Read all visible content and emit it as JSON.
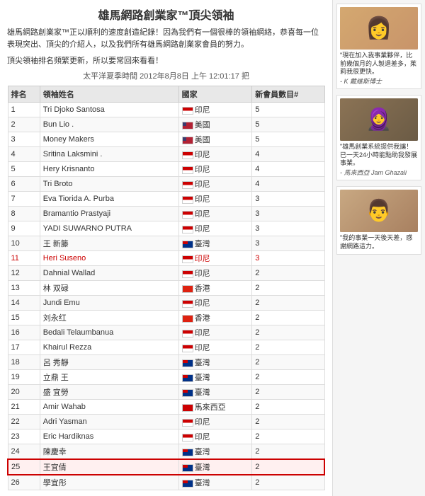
{
  "page": {
    "title": "雄馬網路創業家™頂尖領袖",
    "description": "雄馬網路創業家™正以順利的速度創造紀錄！因為我們有一個很棒的領袖網絡，恭喜每一位表現突出、頂尖的介紹人，以及我們所有雄馬網路創業家會員的努力。",
    "notice": "頂尖領袖排名頻繁更新，所以要常回來看看！",
    "timestamp": "太平洋夏季時間 2012年8月8日 上午 12:01:17 把"
  },
  "table": {
    "headers": [
      "排名",
      "領袖姓名",
      "國家",
      "新會員數目#"
    ],
    "rows": [
      {
        "rank": "1",
        "name": "Tri Djoko Santosa",
        "country": "印尼",
        "flag": "id",
        "count": "5"
      },
      {
        "rank": "2",
        "name": "Bun Lio .",
        "country": "美國",
        "flag": "us",
        "count": "5"
      },
      {
        "rank": "3",
        "name": "Money Makers",
        "country": "美國",
        "flag": "us",
        "count": "5"
      },
      {
        "rank": "4",
        "name": "Sritina Laksmini .",
        "country": "印尼",
        "flag": "id",
        "count": "4"
      },
      {
        "rank": "5",
        "name": "Hery Krisnanto",
        "country": "印尼",
        "flag": "id",
        "count": "4"
      },
      {
        "rank": "6",
        "name": "Tri Broto",
        "country": "印尼",
        "flag": "id",
        "count": "4"
      },
      {
        "rank": "7",
        "name": "Eva Tiorida A. Purba",
        "country": "印尼",
        "flag": "id",
        "count": "3"
      },
      {
        "rank": "8",
        "name": "Bramantio Prastyaji",
        "country": "印尼",
        "flag": "id",
        "count": "3"
      },
      {
        "rank": "9",
        "name": "YADI SUWARNO PUTRA",
        "country": "印尼",
        "flag": "id",
        "count": "3"
      },
      {
        "rank": "10",
        "name": "王 新籐",
        "country": "臺灣",
        "flag": "tw",
        "count": "3"
      },
      {
        "rank": "11",
        "name": "Heri Suseno",
        "country": "印尼",
        "flag": "id",
        "count": "3"
      },
      {
        "rank": "12",
        "name": "Dahnial Wallad",
        "country": "印尼",
        "flag": "id",
        "count": "2"
      },
      {
        "rank": "13",
        "name": "林 双碌",
        "country": "香港",
        "flag": "hk",
        "count": "2"
      },
      {
        "rank": "14",
        "name": "Jundi Emu",
        "country": "印尼",
        "flag": "id",
        "count": "2"
      },
      {
        "rank": "15",
        "name": "刘永红",
        "country": "香港",
        "flag": "hk",
        "count": "2"
      },
      {
        "rank": "16",
        "name": "Bedali Telaumbanua",
        "country": "印尼",
        "flag": "id",
        "count": "2"
      },
      {
        "rank": "17",
        "name": "Khairul Rezza",
        "country": "印尼",
        "flag": "id",
        "count": "2"
      },
      {
        "rank": "18",
        "name": "呂 秀靜",
        "country": "臺灣",
        "flag": "tw",
        "count": "2"
      },
      {
        "rank": "19",
        "name": "立鼎 王",
        "country": "臺灣",
        "flag": "tw",
        "count": "2"
      },
      {
        "rank": "20",
        "name": "盛 宜勞",
        "country": "臺灣",
        "flag": "tw",
        "count": "2"
      },
      {
        "rank": "21",
        "name": "Amir Wahab",
        "country": "馬來西亞",
        "flag": "my",
        "count": "2"
      },
      {
        "rank": "22",
        "name": "Adri Yasman",
        "country": "印尼",
        "flag": "id",
        "count": "2"
      },
      {
        "rank": "23",
        "name": "Eric Hardiknas",
        "country": "印尼",
        "flag": "id",
        "count": "2"
      },
      {
        "rank": "24",
        "name": "陳慶幸",
        "country": "臺灣",
        "flag": "tw",
        "count": "2"
      },
      {
        "rank": "25",
        "name": "王宜倩",
        "country": "臺灣",
        "flag": "tw",
        "count": "2",
        "highlighted": true
      },
      {
        "rank": "26",
        "name": "學宜彤",
        "country": "臺灣",
        "flag": "tw",
        "count": "2"
      }
    ]
  },
  "sidebar": {
    "testimonials": [
      {
        "avatar_type": "woman1",
        "text": "\"現在加入我事業夥伴，比前幾個月的人製退差多，茱莉我很更快。- K 戴維斯博士",
        "partial": true
      },
      {
        "avatar_type": "woman2",
        "text": "\"雄馬創業系統提供我讓！已一天24小時能點助我發展事業。- 馬來西亞 Jam Ghazali",
        "partial": true
      },
      {
        "avatar_type": "man",
        "text": "\"我的事業一天後天差，感謝網路這力。",
        "partial": true
      }
    ]
  }
}
